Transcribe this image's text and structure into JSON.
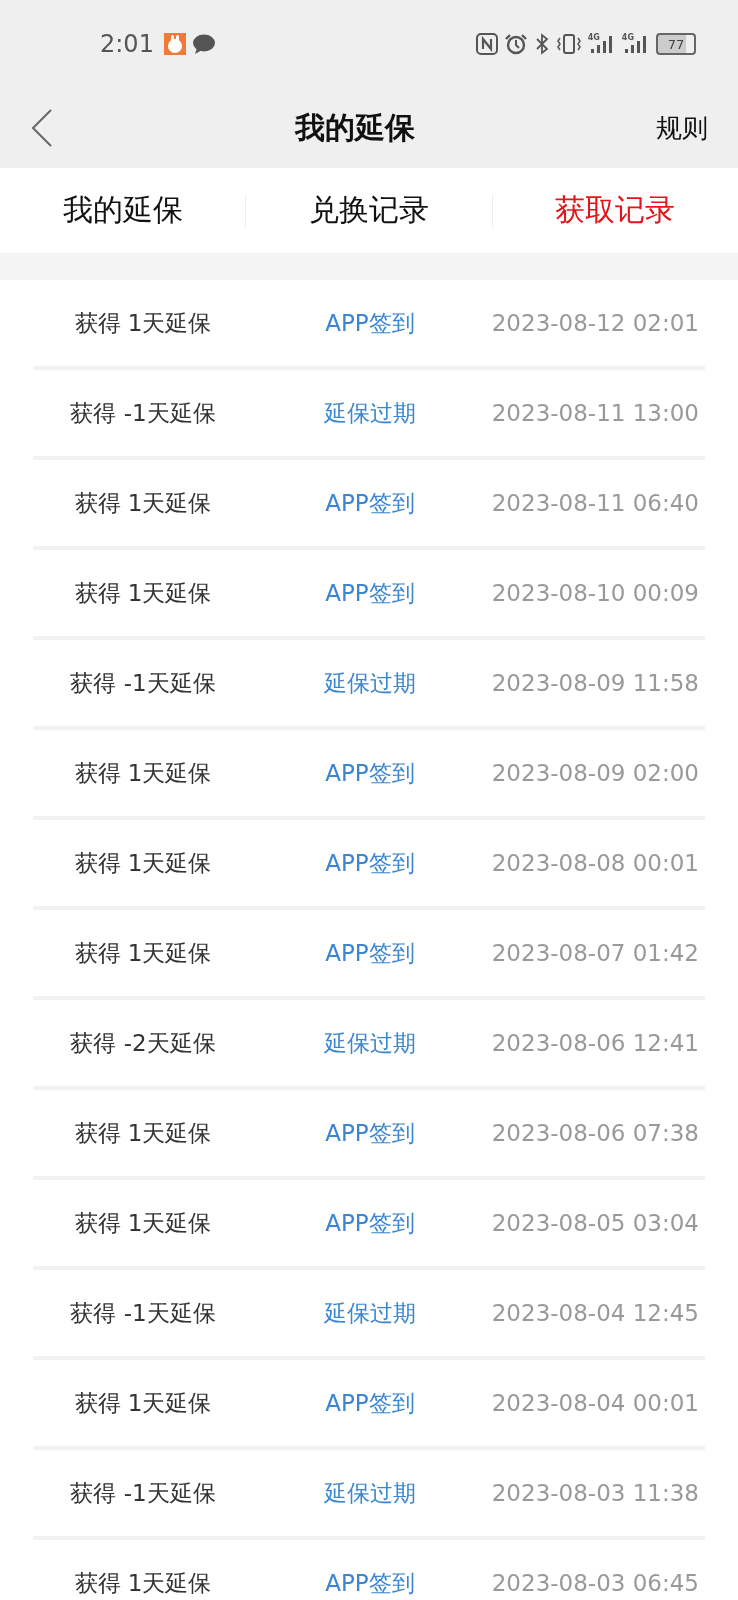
{
  "status_bar": {
    "time": "2:01",
    "signals": [
      {
        "label": "4G"
      },
      {
        "label": "4G"
      }
    ],
    "battery": "77"
  },
  "header": {
    "title": "我的延保",
    "action": "规则"
  },
  "tabs": [
    {
      "label": "我的延保",
      "selected": false
    },
    {
      "label": "兑换记录",
      "selected": false
    },
    {
      "label": "获取记录",
      "selected": true
    }
  ],
  "records": [
    {
      "amount": "获得 1天延保",
      "source": "APP签到",
      "time": "2023-08-12 02:01"
    },
    {
      "amount": "获得 -1天延保",
      "source": "延保过期",
      "time": "2023-08-11 13:00"
    },
    {
      "amount": "获得 1天延保",
      "source": "APP签到",
      "time": "2023-08-11 06:40"
    },
    {
      "amount": "获得 1天延保",
      "source": "APP签到",
      "time": "2023-08-10 00:09"
    },
    {
      "amount": "获得 -1天延保",
      "source": "延保过期",
      "time": "2023-08-09 11:58"
    },
    {
      "amount": "获得 1天延保",
      "source": "APP签到",
      "time": "2023-08-09 02:00"
    },
    {
      "amount": "获得 1天延保",
      "source": "APP签到",
      "time": "2023-08-08 00:01"
    },
    {
      "amount": "获得 1天延保",
      "source": "APP签到",
      "time": "2023-08-07 01:42"
    },
    {
      "amount": "获得 -2天延保",
      "source": "延保过期",
      "time": "2023-08-06 12:41"
    },
    {
      "amount": "获得 1天延保",
      "source": "APP签到",
      "time": "2023-08-06 07:38"
    },
    {
      "amount": "获得 1天延保",
      "source": "APP签到",
      "time": "2023-08-05 03:04"
    },
    {
      "amount": "获得 -1天延保",
      "source": "延保过期",
      "time": "2023-08-04 12:45"
    },
    {
      "amount": "获得 1天延保",
      "source": "APP签到",
      "time": "2023-08-04 00:01"
    },
    {
      "amount": "获得 -1天延保",
      "source": "延保过期",
      "time": "2023-08-03 11:38"
    },
    {
      "amount": "获得 1天延保",
      "source": "APP签到",
      "time": "2023-08-03 06:45"
    }
  ]
}
